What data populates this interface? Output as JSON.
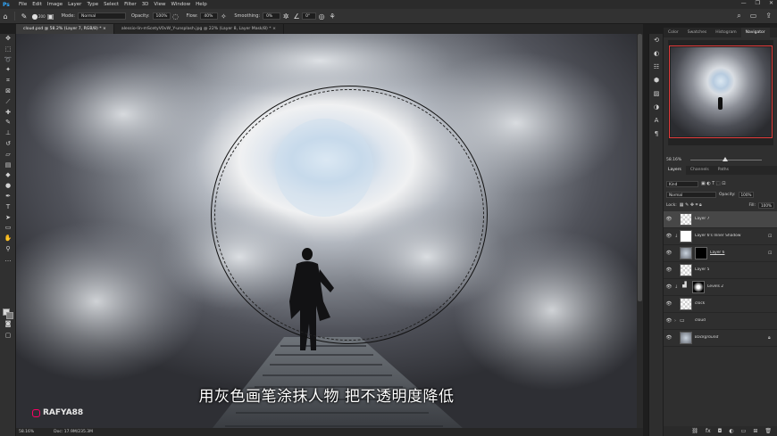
{
  "app": {
    "logo": "Ps",
    "menu": [
      "File",
      "Edit",
      "Image",
      "Layer",
      "Type",
      "Select",
      "Filter",
      "3D",
      "View",
      "Window",
      "Help"
    ],
    "window_controls": [
      "—",
      "❐",
      "✕"
    ]
  },
  "options": {
    "brush_size": "200",
    "mode_label": "Mode:",
    "mode_value": "Normal",
    "opacity_label": "Opacity:",
    "opacity_value": "100%",
    "flow_label": "Flow:",
    "flow_value": "40%",
    "smoothing_label": "Smoothing:",
    "smoothing_value": "0%",
    "angle_value": "0°"
  },
  "tabs": [
    {
      "label": "cloud.psd @ 58.2% (Layer 7, RGB/8) * ×",
      "active": true
    },
    {
      "label": "alessio-lin-mScetyV0vW_Y-unsplash.jpg @ 22% (Layer 8, Layer Mask/8) * ×",
      "active": false
    }
  ],
  "canvas": {
    "subtitle": "用灰色画笔涂抹人物 把不透明度降低",
    "watermark": "RAFYA88"
  },
  "status": {
    "zoom": "58.16%",
    "doc": "Doc: 17.9M/235.3M"
  },
  "panels": {
    "top_tabs": [
      "Color",
      "Swatches",
      "Histogram",
      "Navigator"
    ],
    "active_top_tab": "Navigator",
    "navigator_zoom": "58.16%",
    "layer_tabs": [
      "Layers",
      "Channels",
      "Paths"
    ],
    "kind_label": "Kind",
    "blend_mode": "Normal",
    "opacity_label": "Opacity:",
    "opacity_value": "100%",
    "lock_label": "Lock:",
    "fill_label": "Fill:",
    "fill_value": "100%",
    "layers": [
      {
        "name": "Layer 7",
        "thumb": "checker",
        "active": true
      },
      {
        "name": "Layer 6's Inner Shadow",
        "thumb": "white",
        "active": false
      },
      {
        "name": "Layer 6",
        "thumb": "cloudy",
        "mask": "black",
        "active": false
      },
      {
        "name": "Layer 5",
        "thumb": "checker",
        "active": false
      },
      {
        "name": "Levels 2",
        "thumb": "levels",
        "mask": "radial",
        "active": false
      },
      {
        "name": "clock",
        "thumb": "checker",
        "active": false
      },
      {
        "name": "cloud",
        "thumb": "folder",
        "active": false
      },
      {
        "name": "Background",
        "thumb": "cloudy",
        "active": false
      }
    ]
  },
  "colors": {
    "accent": "#31a8ff",
    "navigator_box": "#e23b3b",
    "panel_bg": "#2f2f2f"
  }
}
